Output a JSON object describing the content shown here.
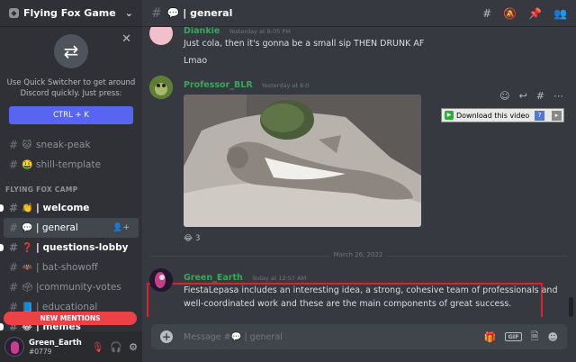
{
  "server": {
    "name": "Flying Fox Game",
    "chevron_icon": "chevron-down-icon"
  },
  "quick_switcher": {
    "text": "Use Quick Switcher to get around Discord quickly. Just press:",
    "shortcut": "CTRL + K"
  },
  "channels_top": [
    {
      "emoji": "🐱",
      "name": "sneak-peak"
    },
    {
      "emoji": "🤑",
      "name": "shill-template"
    }
  ],
  "category": "FLYING FOX CAMP",
  "channels": [
    {
      "emoji": "👏",
      "name": "| welcome",
      "state": "unread"
    },
    {
      "emoji": "💬",
      "name": "| general",
      "state": "active"
    },
    {
      "emoji": "❓",
      "name": "| questions-lobby",
      "state": "unread"
    },
    {
      "emoji": "🦇",
      "name": "| bat-showoff",
      "state": "normal"
    },
    {
      "emoji": "",
      "name": "|community-votes",
      "state": "normal"
    },
    {
      "emoji": "",
      "name": "| educational",
      "state": "normal"
    },
    {
      "emoji": "",
      "name": "| memes",
      "state": "unread"
    }
  ],
  "new_mentions": "NEW MENTIONS",
  "user": {
    "name": "Green_Earth",
    "tag": "#0779"
  },
  "topbar": {
    "channel": "💬 | general"
  },
  "messages": {
    "partial": {
      "author": "Diankie",
      "timestamp": "Yesterday at 8:05 PM",
      "lines": [
        "Just cola, then it's gonna be a small sip THEN DRUNK AF",
        "Lmao"
      ]
    },
    "professor": {
      "author": "Professor_BLR",
      "timestamp": "Yesterday at 8:0",
      "reaction_count": "3",
      "reaction_emoji": "😂",
      "download_label": "Download this video"
    },
    "date_divider": "March 26, 2022",
    "green": {
      "author": "Green_Earth",
      "timestamp": "Today at 12:57 AM",
      "text": "FiestaLepasa includes an interesting idea, a strong, cohesive team of professionals and well-coordinated work and these are the main components of great success."
    }
  },
  "input": {
    "placeholder": "Message #💬 | general",
    "gif_label": "GIF"
  },
  "colors": {
    "accent": "#5865f2",
    "green_author": "#3ba55d",
    "highlight": "#e0202a",
    "mentions": "#ed4245"
  }
}
